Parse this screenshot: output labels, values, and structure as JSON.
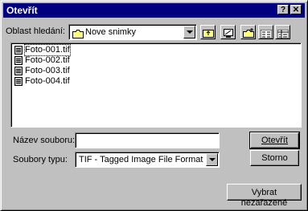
{
  "window": {
    "title": "Otevřít",
    "help_button": "?",
    "close_button": "✕"
  },
  "look_in": {
    "label": "Oblast hledání:",
    "value": "Nove snimky"
  },
  "toolbar": {
    "icons": [
      "up-folder-icon",
      "desktop-icon",
      "new-folder-icon",
      "list-view-icon",
      "details-view-icon"
    ]
  },
  "files": [
    {
      "name": "Foto-001.tif"
    },
    {
      "name": "Foto-002.tif"
    },
    {
      "name": "Foto-003.tif"
    },
    {
      "name": "Foto-004.tif"
    }
  ],
  "filename": {
    "label": "Název souboru:",
    "value": ""
  },
  "filetype": {
    "label": "Soubory typu:",
    "value": "TIF - Tagged Image File Format"
  },
  "buttons": {
    "open": "Otevřít",
    "cancel": "Storno",
    "unsorted": "Vybrat nezařazené"
  }
}
